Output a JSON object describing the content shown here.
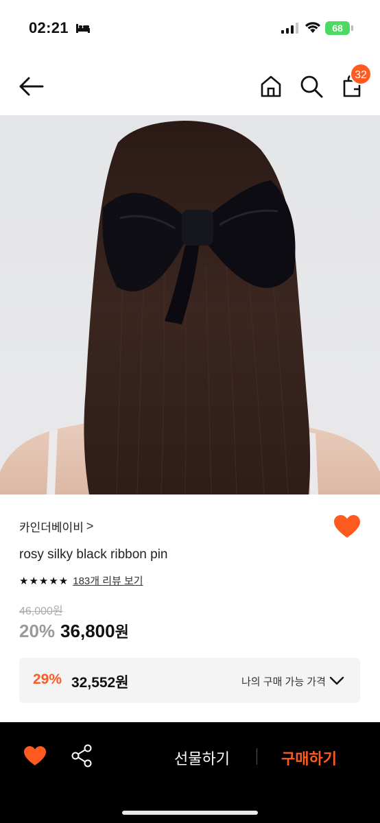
{
  "status_bar": {
    "time": "02:21",
    "battery": "68"
  },
  "nav": {
    "cart_count": "32"
  },
  "product": {
    "brand": "카인더베이비",
    "brand_chevron": ">",
    "name": "rosy silky black ribbon pin",
    "stars": "★★★★★",
    "review_link": "183개 리뷰 보기",
    "original_price": "46,000원",
    "discount": "20%",
    "sale_price": "36,800",
    "won": "원"
  },
  "my_price": {
    "discount": "29%",
    "price": "32,552원",
    "label": "나의 구매 가능 가격"
  },
  "bottom_bar": {
    "gift_label": "선물하기",
    "buy_label": "구매하기"
  },
  "colors": {
    "accent": "#ff5a1f",
    "battery": "#4cd964",
    "bottom_bar": "#000000"
  }
}
